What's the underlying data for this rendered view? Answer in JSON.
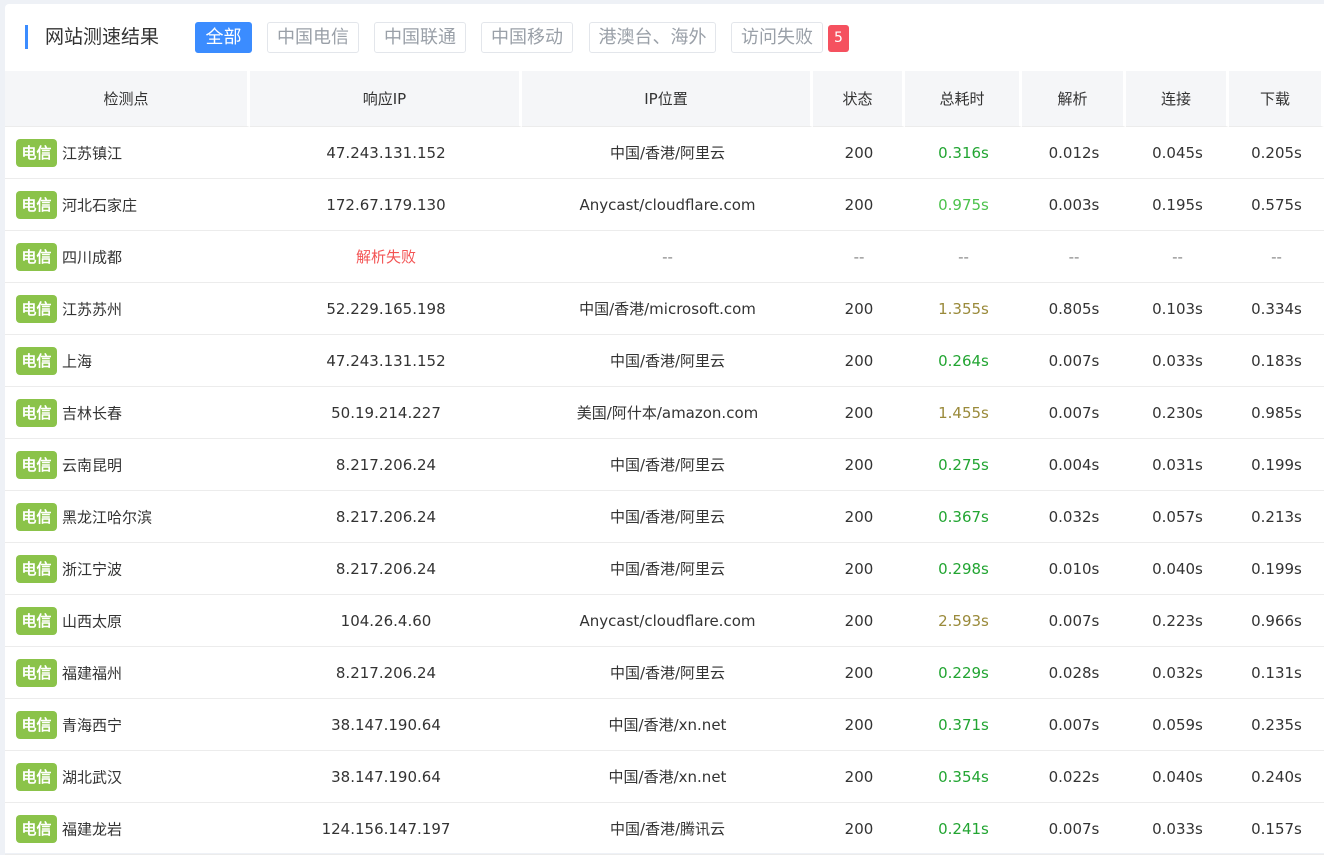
{
  "header": {
    "title": "网站测速结果",
    "tabs": [
      {
        "label": "全部",
        "active": true
      },
      {
        "label": "中国电信",
        "active": false
      },
      {
        "label": "中国联通",
        "active": false
      },
      {
        "label": "中国移动",
        "active": false
      },
      {
        "label": "港澳台、海外",
        "active": false
      },
      {
        "label": "访问失败",
        "active": false
      }
    ],
    "fail_count": "5"
  },
  "table": {
    "columns": [
      "检测点",
      "响应IP",
      "IP位置",
      "状态",
      "总耗时",
      "解析",
      "连接",
      "下载"
    ],
    "rows": [
      {
        "isp": "电信",
        "city": "江苏镇江",
        "ip": "47.243.131.152",
        "location": "中国/香港/阿里云",
        "status": "200",
        "total": "0.316s",
        "total_level": "fast",
        "dns": "0.012s",
        "connect": "0.045s",
        "download": "0.205s"
      },
      {
        "isp": "电信",
        "city": "河北石家庄",
        "ip": "172.67.179.130",
        "location": "Anycast/cloudflare.com",
        "status": "200",
        "total": "0.975s",
        "total_level": "mid",
        "dns": "0.003s",
        "connect": "0.195s",
        "download": "0.575s"
      },
      {
        "isp": "电信",
        "city": "四川成都",
        "ip": "解析失败",
        "ip_error": true,
        "location": "--",
        "status": "--",
        "total": "--",
        "total_level": "none",
        "dns": "--",
        "connect": "--",
        "download": "--"
      },
      {
        "isp": "电信",
        "city": "江苏苏州",
        "ip": "52.229.165.198",
        "location": "中国/香港/microsoft.com",
        "status": "200",
        "total": "1.355s",
        "total_level": "slow",
        "dns": "0.805s",
        "connect": "0.103s",
        "download": "0.334s"
      },
      {
        "isp": "电信",
        "city": "上海",
        "ip": "47.243.131.152",
        "location": "中国/香港/阿里云",
        "status": "200",
        "total": "0.264s",
        "total_level": "fast",
        "dns": "0.007s",
        "connect": "0.033s",
        "download": "0.183s"
      },
      {
        "isp": "电信",
        "city": "吉林长春",
        "ip": "50.19.214.227",
        "location": "美国/阿什本/amazon.com",
        "status": "200",
        "total": "1.455s",
        "total_level": "slow",
        "dns": "0.007s",
        "connect": "0.230s",
        "download": "0.985s"
      },
      {
        "isp": "电信",
        "city": "云南昆明",
        "ip": "8.217.206.24",
        "location": "中国/香港/阿里云",
        "status": "200",
        "total": "0.275s",
        "total_level": "fast",
        "dns": "0.004s",
        "connect": "0.031s",
        "download": "0.199s"
      },
      {
        "isp": "电信",
        "city": "黑龙江哈尔滨",
        "ip": "8.217.206.24",
        "location": "中国/香港/阿里云",
        "status": "200",
        "total": "0.367s",
        "total_level": "fast",
        "dns": "0.032s",
        "connect": "0.057s",
        "download": "0.213s"
      },
      {
        "isp": "电信",
        "city": "浙江宁波",
        "ip": "8.217.206.24",
        "location": "中国/香港/阿里云",
        "status": "200",
        "total": "0.298s",
        "total_level": "fast",
        "dns": "0.010s",
        "connect": "0.040s",
        "download": "0.199s"
      },
      {
        "isp": "电信",
        "city": "山西太原",
        "ip": "104.26.4.60",
        "location": "Anycast/cloudflare.com",
        "status": "200",
        "total": "2.593s",
        "total_level": "slow",
        "dns": "0.007s",
        "connect": "0.223s",
        "download": "0.966s"
      },
      {
        "isp": "电信",
        "city": "福建福州",
        "ip": "8.217.206.24",
        "location": "中国/香港/阿里云",
        "status": "200",
        "total": "0.229s",
        "total_level": "fast",
        "dns": "0.028s",
        "connect": "0.032s",
        "download": "0.131s"
      },
      {
        "isp": "电信",
        "city": "青海西宁",
        "ip": "38.147.190.64",
        "location": "中国/香港/xn.net",
        "status": "200",
        "total": "0.371s",
        "total_level": "fast",
        "dns": "0.007s",
        "connect": "0.059s",
        "download": "0.235s"
      },
      {
        "isp": "电信",
        "city": "湖北武汉",
        "ip": "38.147.190.64",
        "location": "中国/香港/xn.net",
        "status": "200",
        "total": "0.354s",
        "total_level": "fast",
        "dns": "0.022s",
        "connect": "0.040s",
        "download": "0.240s"
      },
      {
        "isp": "电信",
        "city": "福建龙岩",
        "ip": "124.156.147.197",
        "location": "中国/香港/腾讯云",
        "status": "200",
        "total": "0.241s",
        "total_level": "fast",
        "dns": "0.007s",
        "connect": "0.033s",
        "download": "0.157s"
      }
    ]
  },
  "colors": {
    "accent": "#3b8cff",
    "isp_badge": "#8bc34a",
    "fail_badge": "#f5515f",
    "time_fast": "#22a532",
    "time_mid": "#4cc24c",
    "time_slow": "#9a8a3a",
    "error": "#f35454"
  }
}
